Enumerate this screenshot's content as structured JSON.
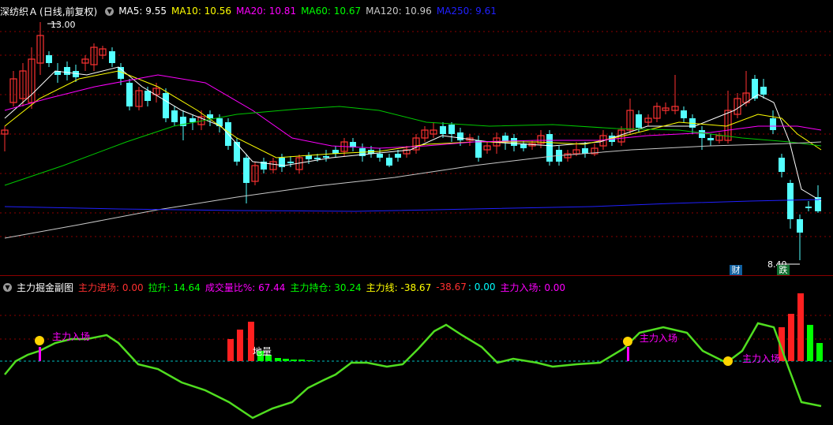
{
  "main": {
    "title": "深纺织Ａ",
    "period": "(日线,前复权)",
    "ma": [
      {
        "label": "MA5: 9.55",
        "color": "#ffffff"
      },
      {
        "label": "MA10: 10.56",
        "color": "#ffff00"
      },
      {
        "label": "MA20: 10.81",
        "color": "#ff00ff"
      },
      {
        "label": "MA60: 10.67",
        "color": "#00ff00"
      },
      {
        "label": "MA120: 10.96",
        "color": "#c8c8c8"
      },
      {
        "label": "MA250: 9.61",
        "color": "#2020ff"
      }
    ],
    "high_label": "13.00",
    "low_label": "8.40",
    "badge_cai": "财",
    "badge_die": "跌"
  },
  "sub": {
    "title": "主力掘金副图",
    "items": [
      {
        "label": "主力进场: 0.00",
        "color": "#ff3030"
      },
      {
        "label": "拉升: 14.64",
        "color": "#00ff00"
      },
      {
        "label": "成交量比%: 67.44",
        "color": "#ff00ff"
      },
      {
        "label": "主力持仓: 30.24",
        "color": "#00ff00"
      },
      {
        "label": "主力线: -38.67",
        "color": "#ffff00"
      },
      {
        "label": "-38.67",
        "color": "#ff3030"
      },
      {
        "label": ": 0.00",
        "color": "#00ffff"
      },
      {
        "label": "主力入场: 0.00",
        "color": "#ff00ff"
      }
    ],
    "entry_label": "主力入场",
    "bottom_label": "地量"
  },
  "colors": {
    "up": "#ff3232",
    "down": "#54ffff",
    "grid": "#8b0000"
  }
}
